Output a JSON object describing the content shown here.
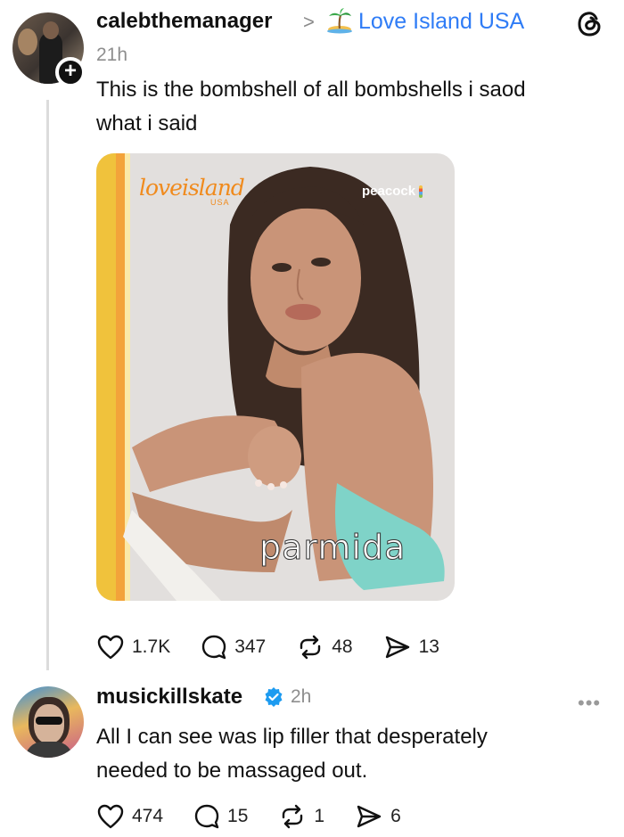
{
  "post": {
    "username": "calebthemanager",
    "separator": ">",
    "community": "Love Island USA",
    "time": "21h",
    "text_line1": "This is the bombshell of all bombshells i saod",
    "text_line2": "what i said",
    "follow_symbol": "+",
    "media": {
      "logo_text": "loveisland",
      "logo_sub": "USA",
      "network": "peacock",
      "name_overlay": "parmida"
    },
    "actions": {
      "likes": "1.7K",
      "replies": "347",
      "reposts": "48",
      "shares": "13"
    }
  },
  "reply": {
    "username": "musickillskate",
    "time": "2h",
    "text_line1": "All I can see was lip filler that desperately",
    "text_line2": "needed to be massaged out.",
    "more": "•••",
    "actions": {
      "likes": "474",
      "replies": "15",
      "reposts": "1",
      "shares": "6"
    }
  },
  "colors": {
    "link_blue": "#2f7cf6",
    "secondary_gray": "#8e8e8e",
    "verified_blue": "#1d9bf0",
    "brand_orange": "#f08a1c"
  },
  "icons": {
    "community": "palm-island-icon",
    "app": "threads-logo-icon",
    "like": "heart-icon",
    "reply": "comment-bubble-icon",
    "repost": "repost-arrows-icon",
    "share": "send-icon",
    "verified": "verified-badge-icon"
  }
}
